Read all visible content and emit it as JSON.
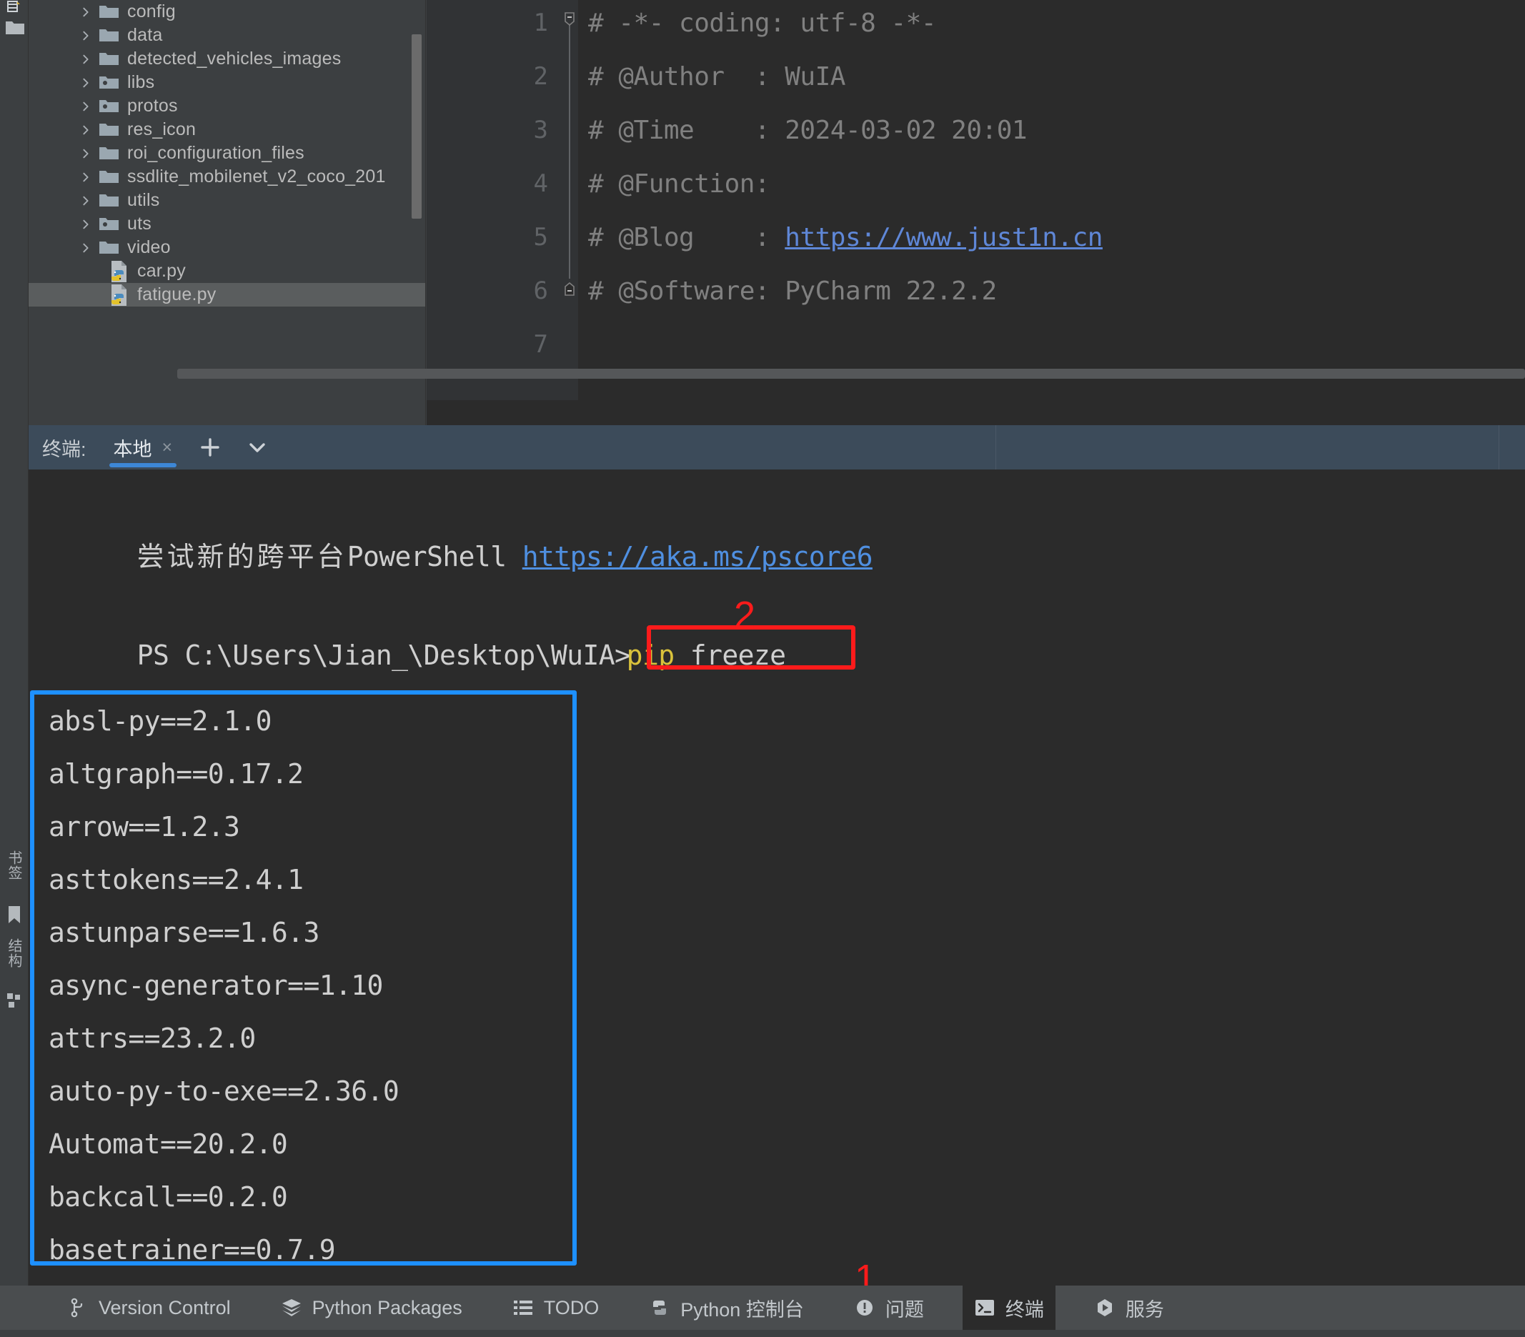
{
  "project_tree": {
    "items": [
      {
        "label": "config",
        "type": "folder",
        "expandable": true,
        "icon": "folder-icon",
        "selected": false
      },
      {
        "label": "data",
        "type": "folder",
        "expandable": true,
        "icon": "folder-icon",
        "selected": false
      },
      {
        "label": "detected_vehicles_images",
        "type": "folder",
        "expandable": true,
        "icon": "folder-icon",
        "selected": false
      },
      {
        "label": "libs",
        "type": "folder",
        "expandable": true,
        "icon": "folder-package-icon",
        "selected": false
      },
      {
        "label": "protos",
        "type": "folder",
        "expandable": true,
        "icon": "folder-package-icon",
        "selected": false
      },
      {
        "label": "res_icon",
        "type": "folder",
        "expandable": true,
        "icon": "folder-icon",
        "selected": false
      },
      {
        "label": "roi_configuration_files",
        "type": "folder",
        "expandable": true,
        "icon": "folder-icon",
        "selected": false
      },
      {
        "label": "ssdlite_mobilenet_v2_coco_201",
        "type": "folder",
        "expandable": true,
        "icon": "folder-icon",
        "selected": false
      },
      {
        "label": "utils",
        "type": "folder",
        "expandable": true,
        "icon": "folder-icon",
        "selected": false
      },
      {
        "label": "uts",
        "type": "folder",
        "expandable": true,
        "icon": "folder-package-icon",
        "selected": false
      },
      {
        "label": "video",
        "type": "folder",
        "expandable": true,
        "icon": "folder-icon",
        "selected": false
      },
      {
        "label": "car.py",
        "type": "file",
        "expandable": false,
        "icon": "python-file-icon",
        "selected": false
      },
      {
        "label": "fatigue.py",
        "type": "file",
        "expandable": false,
        "icon": "python-file-icon",
        "selected": true
      }
    ]
  },
  "editor": {
    "line_numbers": [
      "1",
      "2",
      "3",
      "4",
      "5",
      "6",
      "7"
    ],
    "lines": [
      {
        "text": "# -*- coding: utf-8 -*-",
        "link": ""
      },
      {
        "text": "# @Author  : WuIA",
        "link": ""
      },
      {
        "text": "# @Time    : 2024-03-02 20:01",
        "link": ""
      },
      {
        "text": "# @Function:",
        "link": ""
      },
      {
        "text": "# @Blog    : ",
        "link": "https://www.just1n.cn"
      },
      {
        "text": "# @Software: PyCharm 22.2.2",
        "link": ""
      },
      {
        "text": "",
        "link": ""
      }
    ]
  },
  "terminal_tabbar": {
    "title": "终端:",
    "tab_name": "本地",
    "close_glyph": "×",
    "add_glyph": "+",
    "dropdown_glyph": "⌄"
  },
  "terminal": {
    "banner_cjk": "尝试新的跨平台",
    "banner_shell": "PowerShell",
    "banner_url": "https://aka.ms/pscore6",
    "prompt": "PS C:\\Users\\Jian_\\Desktop\\WuIA>",
    "command_keyword": "pip",
    "command_arg": " freeze",
    "output_lines": [
      "absl-py==2.1.0",
      "altgraph==0.17.2",
      "arrow==1.2.3",
      "asttokens==2.4.1",
      "astunparse==1.6.3",
      "async-generator==1.10",
      "attrs==23.2.0",
      "auto-py-to-exe==2.36.0",
      "Automat==20.2.0",
      "backcall==0.2.0",
      "basetrainer==0.7.9"
    ]
  },
  "annotations": {
    "step_one": "1",
    "step_two": "2",
    "red_color": "#fc1b1b",
    "blue_color": "#1e90ff"
  },
  "left_rail": {
    "bookmarks_label": "书签",
    "structure_label": "结构"
  },
  "statusbar": {
    "items": [
      {
        "label": "Version Control",
        "icon": "branch-icon",
        "active": false
      },
      {
        "label": "Python Packages",
        "icon": "layers-icon",
        "active": false
      },
      {
        "label": "TODO",
        "icon": "list-icon",
        "active": false
      },
      {
        "label": "Python 控制台",
        "icon": "python-icon",
        "active": false
      },
      {
        "label": "问题",
        "icon": "warning-icon",
        "active": false
      },
      {
        "label": "终端",
        "icon": "terminal-icon",
        "active": true
      },
      {
        "label": "服务",
        "icon": "play-icon",
        "active": false
      }
    ]
  }
}
